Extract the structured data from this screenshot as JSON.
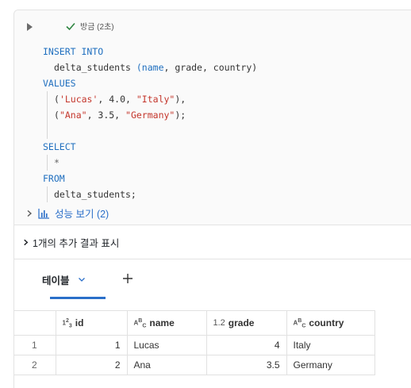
{
  "cell": {
    "status_text": "방금 (2초)",
    "status_color": "#2e8540",
    "keyword_color": "#1f6fbf",
    "string_color": "#c4362c"
  },
  "code": {
    "l1": "INSERT INTO",
    "l2_table": "delta_students",
    "l2_paren_open": " (",
    "l2_col1": "name",
    "l2_rest": ", grade, country)",
    "l3": "VALUES",
    "l4_open": "(",
    "l4_s1": "'Lucas'",
    "l4_mid": ", 4.0, ",
    "l4_s2": "\"Italy\"",
    "l4_close": "),",
    "l5_open": "(",
    "l5_s1": "\"Ana\"",
    "l5_mid": ", 3.5, ",
    "l5_s2": "\"Germany\"",
    "l5_close": ");",
    "l7": "SELECT",
    "l8": "*",
    "l9": "FROM",
    "l10": "delta_students;"
  },
  "performance": {
    "label": "성능 보기 (2)"
  },
  "more_results": {
    "label": "1개의 추가 결과 표시"
  },
  "results": {
    "tab_label": "테이블",
    "add_tab": "+",
    "columns": [
      {
        "type_top": "1",
        "type_sup": "2",
        "type_sub": "3",
        "name": "id"
      },
      {
        "type_top": "A",
        "type_sup": "B",
        "type_sub": "C",
        "name": "name"
      },
      {
        "type_top": "1.2",
        "type_sup": "",
        "type_sub": "",
        "name": "grade"
      },
      {
        "type_top": "A",
        "type_sup": "B",
        "type_sub": "C",
        "name": "country"
      }
    ],
    "rows": [
      {
        "index": "1",
        "id": "1",
        "name": "Lucas",
        "grade": "4",
        "country": "Italy"
      },
      {
        "index": "2",
        "id": "2",
        "name": "Ana",
        "grade": "3.5",
        "country": "Germany"
      }
    ]
  }
}
